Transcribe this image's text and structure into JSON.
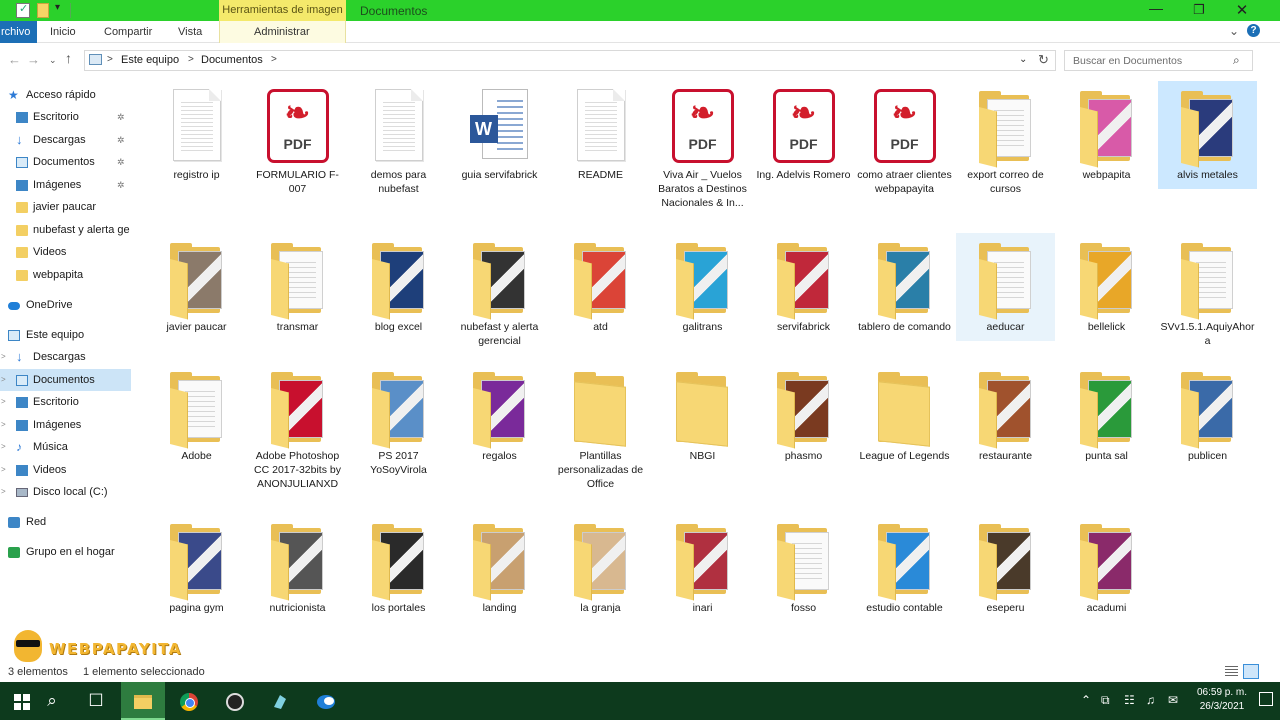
{
  "titlebar": {
    "context_tab": "Herramientas de imagen",
    "title": "Documentos",
    "minimize": "—",
    "maximize": "❐",
    "close": "✕"
  },
  "ribbon": {
    "tabs": [
      "rchivo",
      "Inicio",
      "Compartir",
      "Vista",
      "Administrar"
    ],
    "chevron": "⌄",
    "help": "?"
  },
  "address": {
    "back": "←",
    "forward": "→",
    "dropdown": "⌄",
    "up": "↑",
    "crumbs": [
      "Este equipo",
      "Documentos"
    ],
    "separator": ">",
    "refresh": "↻",
    "search_placeholder": "Buscar en Documentos",
    "search_icon": "⌕"
  },
  "nav": {
    "items": [
      {
        "label": "Acceso rápido",
        "icon": "star-icon",
        "pinned": false
      },
      {
        "label": "Escritorio",
        "icon": "desktop-icon",
        "pinned": true
      },
      {
        "label": "Descargas",
        "icon": "download-icon",
        "pinned": true
      },
      {
        "label": "Documentos",
        "icon": "documents-icon",
        "pinned": true
      },
      {
        "label": "Imágenes",
        "icon": "pictures-icon",
        "pinned": true
      },
      {
        "label": "javier paucar",
        "icon": "folder-icon",
        "pinned": false
      },
      {
        "label": "nubefast y alerta ge",
        "icon": "folder-icon",
        "pinned": false
      },
      {
        "label": "Videos",
        "icon": "folder-icon",
        "pinned": false
      },
      {
        "label": "webpapita",
        "icon": "folder-icon",
        "pinned": false
      },
      {
        "label": "OneDrive",
        "icon": "onedrive-icon",
        "pinned": false
      },
      {
        "label": "Este equipo",
        "icon": "computer-icon",
        "pinned": false
      },
      {
        "label": "Descargas",
        "icon": "download-icon",
        "pinned": false
      },
      {
        "label": "Documentos",
        "icon": "documents-icon",
        "pinned": false,
        "selected": true
      },
      {
        "label": "Escritorio",
        "icon": "desktop-icon",
        "pinned": false
      },
      {
        "label": "Imágenes",
        "icon": "pictures-icon",
        "pinned": false
      },
      {
        "label": "Música",
        "icon": "music-icon",
        "pinned": false
      },
      {
        "label": "Videos",
        "icon": "videos-icon",
        "pinned": false
      },
      {
        "label": "Disco local (C:)",
        "icon": "disk-icon",
        "pinned": false
      },
      {
        "label": "Red",
        "icon": "network-icon",
        "pinned": false
      },
      {
        "label": "Grupo en el hogar",
        "icon": "homegroup-icon",
        "pinned": false
      }
    ],
    "pin_glyph": "📌",
    "expander_glyph": ">"
  },
  "files": [
    {
      "name": "registro ip",
      "kind": "doc"
    },
    {
      "name": "FORMULARIO F-007",
      "kind": "pdf"
    },
    {
      "name": "demos para nubefast",
      "kind": "doc"
    },
    {
      "name": "guia servifabrick",
      "kind": "word"
    },
    {
      "name": "README",
      "kind": "doc"
    },
    {
      "name": "Viva Air _ Vuelos Baratos a Destinos Nacionales & In...",
      "kind": "pdf"
    },
    {
      "name": "Ing. Adelvis Romero",
      "kind": "pdf"
    },
    {
      "name": "como atraer clientes webpapayita",
      "kind": "pdf"
    },
    {
      "name": "export correo de cursos",
      "kind": "folder"
    },
    {
      "name": "webpapita",
      "kind": "folder",
      "accent": "#d85aa8"
    },
    {
      "name": "alvis metales",
      "kind": "folder",
      "accent": "#2a3b7c",
      "state": "selected"
    },
    {
      "name": "javier paucar",
      "kind": "folder",
      "accent": "#8b7a6a"
    },
    {
      "name": "transmar",
      "kind": "folder"
    },
    {
      "name": "blog excel",
      "kind": "folder",
      "accent": "#1e3f7a"
    },
    {
      "name": "nubefast y alerta gerencial",
      "kind": "folder",
      "accent": "#333333"
    },
    {
      "name": "atd",
      "kind": "folder",
      "accent": "#db4437"
    },
    {
      "name": "galitrans",
      "kind": "folder",
      "accent": "#29a3d6"
    },
    {
      "name": "servifabrick",
      "kind": "folder",
      "accent": "#c0283a"
    },
    {
      "name": "tablero de comando",
      "kind": "folder",
      "accent": "#2a7fa8"
    },
    {
      "name": "aeducar",
      "kind": "folder",
      "state": "hovered"
    },
    {
      "name": "bellelick",
      "kind": "folder",
      "accent": "#e8a728"
    },
    {
      "name": "SVv1.5.1.AquiyAhora",
      "kind": "folder"
    },
    {
      "name": "Adobe",
      "kind": "folder"
    },
    {
      "name": "Adobe Photoshop CC 2017-32bits by ANONJULIANXD",
      "kind": "folder",
      "accent": "#c8102e"
    },
    {
      "name": "PS 2017 YoSoyVirola",
      "kind": "folder",
      "accent": "#5a8fc8"
    },
    {
      "name": "regalos",
      "kind": "folder",
      "accent": "#7a2a9a"
    },
    {
      "name": "Plantillas personalizadas de Office",
      "kind": "folder-empty"
    },
    {
      "name": "NBGI",
      "kind": "folder-empty"
    },
    {
      "name": "phasmo",
      "kind": "folder",
      "accent": "#7a3a20"
    },
    {
      "name": "League of Legends",
      "kind": "folder-empty"
    },
    {
      "name": "restaurante",
      "kind": "folder",
      "accent": "#a0522d"
    },
    {
      "name": "punta sal",
      "kind": "folder",
      "accent": "#2a9a3a"
    },
    {
      "name": "publicen",
      "kind": "folder",
      "accent": "#3a6aa8"
    },
    {
      "name": "pagina gym",
      "kind": "folder",
      "accent": "#3a4a8a"
    },
    {
      "name": "nutricionista",
      "kind": "folder",
      "accent": "#555555"
    },
    {
      "name": "los portales",
      "kind": "folder",
      "accent": "#2a2a2a"
    },
    {
      "name": "landing",
      "kind": "folder",
      "accent": "#c8a070"
    },
    {
      "name": "la granja",
      "kind": "folder",
      "accent": "#d8b890"
    },
    {
      "name": "inari",
      "kind": "folder",
      "accent": "#b03040"
    },
    {
      "name": "fosso",
      "kind": "folder"
    },
    {
      "name": "estudio contable",
      "kind": "folder",
      "accent": "#2a8ad8"
    },
    {
      "name": "eseperu",
      "kind": "folder",
      "accent": "#4a3a2a"
    },
    {
      "name": "acadumi",
      "kind": "folder",
      "accent": "#8a2a6a"
    }
  ],
  "status": {
    "count": "3 elementos",
    "selection": "1 elemento seleccionado"
  },
  "watermark": {
    "text": "WEBPAPAYITA"
  },
  "taskbar": {
    "start_icon": "windows-icon",
    "search_glyph": "⌕",
    "taskview_glyph": "☐",
    "tray": [
      "⌃",
      "⧉",
      "☷",
      "♫",
      "✉"
    ],
    "time": "06:59 p. m.",
    "date": "26/3/2021"
  },
  "colors": {
    "titlebar": "#2bd12b",
    "context_tab": "#f4e96b",
    "accent_blue": "#1c6fb6",
    "selected": "#cce4f7",
    "folder": "#f3cf63",
    "pdf_red": "#c8102e",
    "taskbar": "#0d3a1d"
  }
}
